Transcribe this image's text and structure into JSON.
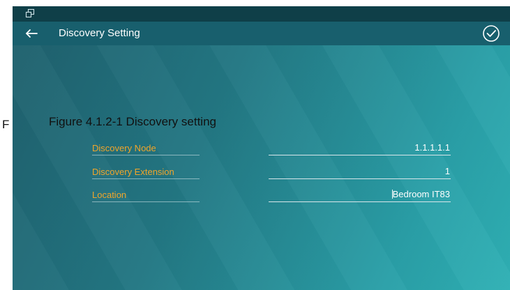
{
  "header": {
    "title": "Discovery Setting"
  },
  "caption": {
    "stray_letter": "F",
    "text": "Figure 4.1.2-1 Discovery setting"
  },
  "fields": [
    {
      "label": "Discovery Node",
      "value": "1.1.1.1.1"
    },
    {
      "label": "Discovery Extension",
      "value": "1"
    },
    {
      "label": "Location",
      "value": "Bedroom IT83"
    }
  ],
  "colors": {
    "label": "#f0a52a",
    "value": "#ffffff",
    "status_bar": "#0f3f48",
    "title_bar": "#185f6d"
  },
  "icons": {
    "status": "window-restore-icon",
    "back": "arrow-left-icon",
    "confirm": "check-circle-icon"
  }
}
